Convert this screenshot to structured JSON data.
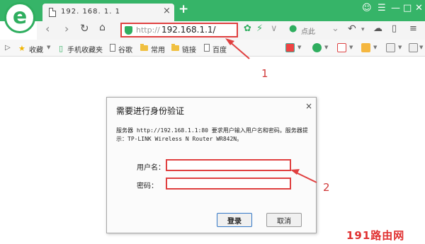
{
  "browser": {
    "logo_letter": "e",
    "tab_title": "192. 168. 1. 1",
    "tab_close": "×",
    "new_tab": "+",
    "address_protocol": "http://",
    "address_host": "192.168.1.1/",
    "search_label": "点此",
    "window_controls": [
      "☺",
      "☰",
      "—",
      "□",
      "✕"
    ]
  },
  "bookmarks": {
    "favorites": "收藏",
    "mobile_favorites": "手机收藏夹",
    "items": [
      "谷歌",
      "常用",
      "链接",
      "百度"
    ]
  },
  "dialog": {
    "title": "需要进行身份验证",
    "close": "×",
    "message": "服务器 http://192.168.1.1:80 要求用户输入用户名和密码。服务器提示：TP-LINK Wireless N Router WR842N。",
    "username_label": "用户名：",
    "username_value": "",
    "password_label": "密码：",
    "password_value": "",
    "login_button": "登录",
    "cancel_button": "取消"
  },
  "annotations": {
    "step_1": "1",
    "step_2": "2",
    "accent_color": "#e04040"
  },
  "watermark": "191路由网"
}
